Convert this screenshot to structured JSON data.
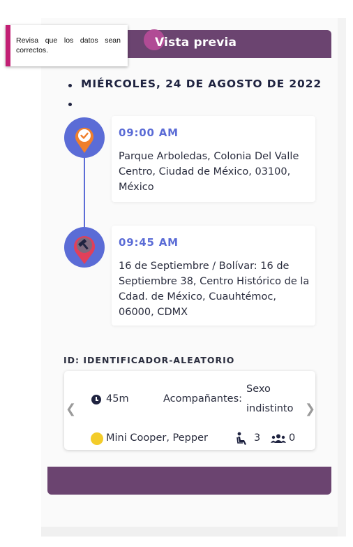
{
  "tooltip": {
    "text": "Revisa que los datos sean correctos."
  },
  "header": {
    "title": "Vista previa"
  },
  "date": {
    "label": "MIÉRCOLES, 24 DE AGOSTO DE 2022"
  },
  "stops": [
    {
      "time": "09:00 AM",
      "address": "Parque Arboledas, Colonia Del Valle Centro, Ciudad de México, 03100, México",
      "icon": "checkmark-pin-icon",
      "pin_color": "#f07f2c"
    },
    {
      "time": "09:45 AM",
      "address": "16 de Septiembre / Bolívar: 16 de Septiembre 38, Centro Histórico de la Cdad. de México, Cuauhtémoc, 06000, CDMX",
      "icon": "gavel-pin-icon",
      "pin_color": "#e0405a"
    }
  ],
  "trip": {
    "id_label": "ID: IDENTIFICADOR-ALEATORIO",
    "duration": "45m",
    "companions_label": "Acompañantes:",
    "companions_value_line1": "Sexo",
    "companions_value_line2": "indistinto",
    "vehicle": "Mini Cooper, Pepper",
    "seats": "3",
    "group": "0"
  },
  "colors": {
    "header": "#6b4470",
    "accent": "#5b6cd6",
    "tooltip_bar": "#c21f74",
    "vehicle_color": "#f3cc2a"
  }
}
